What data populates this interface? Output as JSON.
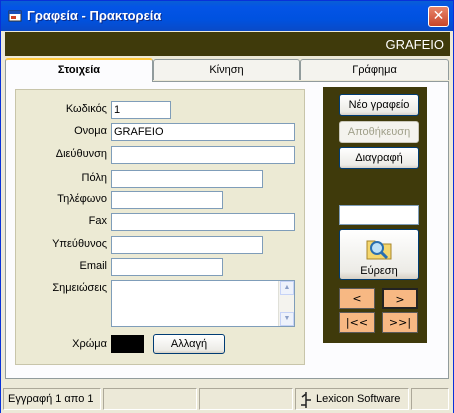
{
  "window": {
    "title": "Γραφεία - Πρακτορεία",
    "close": "✕"
  },
  "banner": {
    "text": "GRAFEIO"
  },
  "tabs": [
    {
      "label": "Στοιχεία"
    },
    {
      "label": "Κίνηση"
    },
    {
      "label": "Γράφημα"
    }
  ],
  "form": {
    "code_label": "Κωδικός",
    "code_value": "1",
    "name_label": "Ονομα",
    "name_value": "GRAFEIO",
    "address_label": "Διεύθυνση",
    "address_value": "",
    "city_label": "Πόλη",
    "city_value": "",
    "phone_label": "Τηλέφωνο",
    "phone_value": "",
    "fax_label": "Fax",
    "fax_value": "",
    "manager_label": "Υπεύθυνος",
    "manager_value": "",
    "email_label": "Email",
    "email_value": "",
    "notes_label": "Σημειώσεις",
    "notes_value": "",
    "color_label": "Χρώμα",
    "color_value": "#000000",
    "change_button": "Αλλαγή"
  },
  "actions": {
    "new_button": "Νέο γραφείο",
    "save_button": "Αποθήκευση",
    "delete_button": "Διαγραφή",
    "search_value": "",
    "search_button": "Εύρεση"
  },
  "nav": {
    "prev": "<",
    "next": ">",
    "first": "|<<",
    "last": ">>|"
  },
  "status": {
    "record_text": "Εγγραφή 1 απο 1",
    "brand": "Lexicon Software"
  },
  "colors": {
    "banner": "#3f3a0b",
    "nav_button": "#f7b883",
    "titlebar": "#0052e0"
  }
}
